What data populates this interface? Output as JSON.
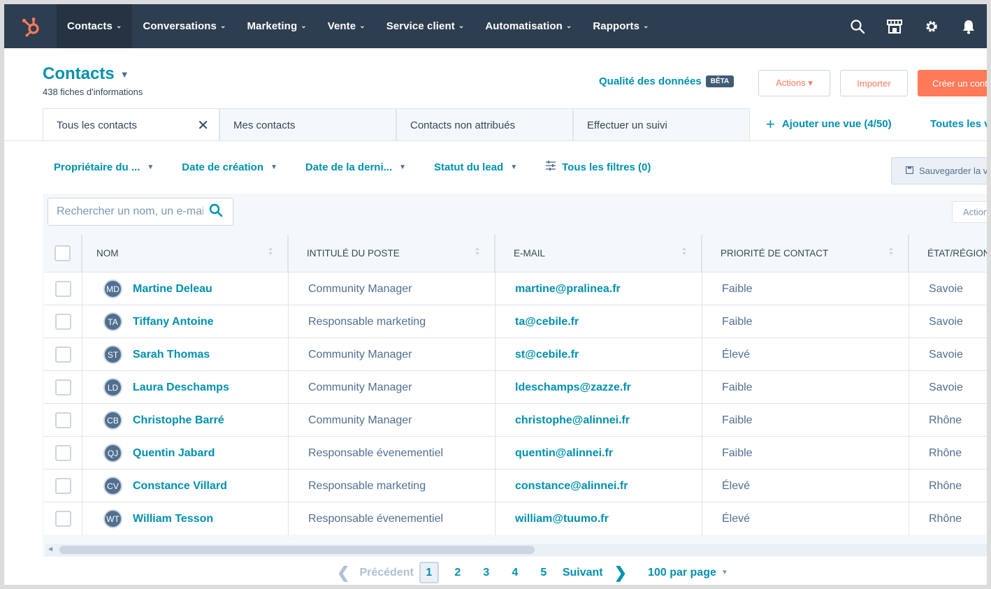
{
  "nav": {
    "items": [
      {
        "label": "Contacts"
      },
      {
        "label": "Conversations"
      },
      {
        "label": "Marketing"
      },
      {
        "label": "Vente"
      },
      {
        "label": "Service client"
      },
      {
        "label": "Automatisation"
      },
      {
        "label": "Rapports"
      }
    ],
    "chevron": "⌄",
    "icons": [
      "search-icon",
      "marketplace-icon",
      "gear-icon",
      "bell-icon"
    ]
  },
  "header": {
    "title": "Contacts",
    "record_count": "438 fiches d'informations",
    "data_quality": "Qualité des données",
    "beta": "BÊTA",
    "actions": "Actions ▾",
    "import": "Importer",
    "create": "Créer un contact"
  },
  "views": {
    "tabs": [
      {
        "label": "Tous les contacts"
      },
      {
        "label": "Mes contacts"
      },
      {
        "label": "Contacts non attribués"
      },
      {
        "label": "Effectuer un suivi"
      }
    ],
    "add_view": "Ajouter une vue (4/50)",
    "all_views": "Toutes les vues"
  },
  "filters": {
    "items": [
      {
        "label": "Propriétaire du ..."
      },
      {
        "label": "Date de création"
      },
      {
        "label": "Date de la derni..."
      },
      {
        "label": "Statut du lead"
      }
    ],
    "all_filters": "Tous les filtres (0)",
    "save": "Sauvegarder la vue"
  },
  "table": {
    "search_placeholder": "Rechercher un nom, un e-mail",
    "actions": "Actions",
    "columns": [
      "NOM",
      "INTITULÉ DU POSTE",
      "E-MAIL",
      "PRIORITÉ DE CONTACT",
      "ÉTAT/RÉGION"
    ],
    "rows": [
      {
        "initials": "MD",
        "name": "Martine Deleau",
        "job": "Community Manager",
        "email": "martine@pralinea.fr",
        "priority": "Faible",
        "region": "Savoie"
      },
      {
        "initials": "TA",
        "name": "Tiffany Antoine",
        "job": "Responsable marketing",
        "email": "ta@cebile.fr",
        "priority": "Faible",
        "region": "Savoie"
      },
      {
        "initials": "ST",
        "name": "Sarah Thomas",
        "job": "Community Manager",
        "email": "st@cebile.fr",
        "priority": "Élevé",
        "region": "Savoie"
      },
      {
        "initials": "LD",
        "name": "Laura Deschamps",
        "job": "Community Manager",
        "email": "ldeschamps@zazze.fr",
        "priority": "Faible",
        "region": "Savoie"
      },
      {
        "initials": "CB",
        "name": "Christophe Barré",
        "job": "Community Manager",
        "email": "christophe@alinnei.fr",
        "priority": "Faible",
        "region": "Rhône"
      },
      {
        "initials": "QJ",
        "name": "Quentin Jabard",
        "job": "Responsable évenementiel",
        "email": "quentin@alinnei.fr",
        "priority": "Faible",
        "region": "Rhône"
      },
      {
        "initials": "CV",
        "name": "Constance Villard",
        "job": "Responsable marketing",
        "email": "constance@alinnei.fr",
        "priority": "Élevé",
        "region": "Rhône"
      },
      {
        "initials": "WT",
        "name": "William Tesson",
        "job": "Responsable évenementiel",
        "email": "william@tuumo.fr",
        "priority": "Élevé",
        "region": "Rhône"
      }
    ]
  },
  "pager": {
    "prev": "Précédent",
    "pages": [
      "1",
      "2",
      "3",
      "4",
      "5"
    ],
    "current": "1",
    "next": "Suivant",
    "per_page": "100 par page"
  },
  "colors": {
    "nav_bg": "#2d3e50",
    "accent": "#0091ae",
    "brand_orange": "#ff7a59"
  }
}
